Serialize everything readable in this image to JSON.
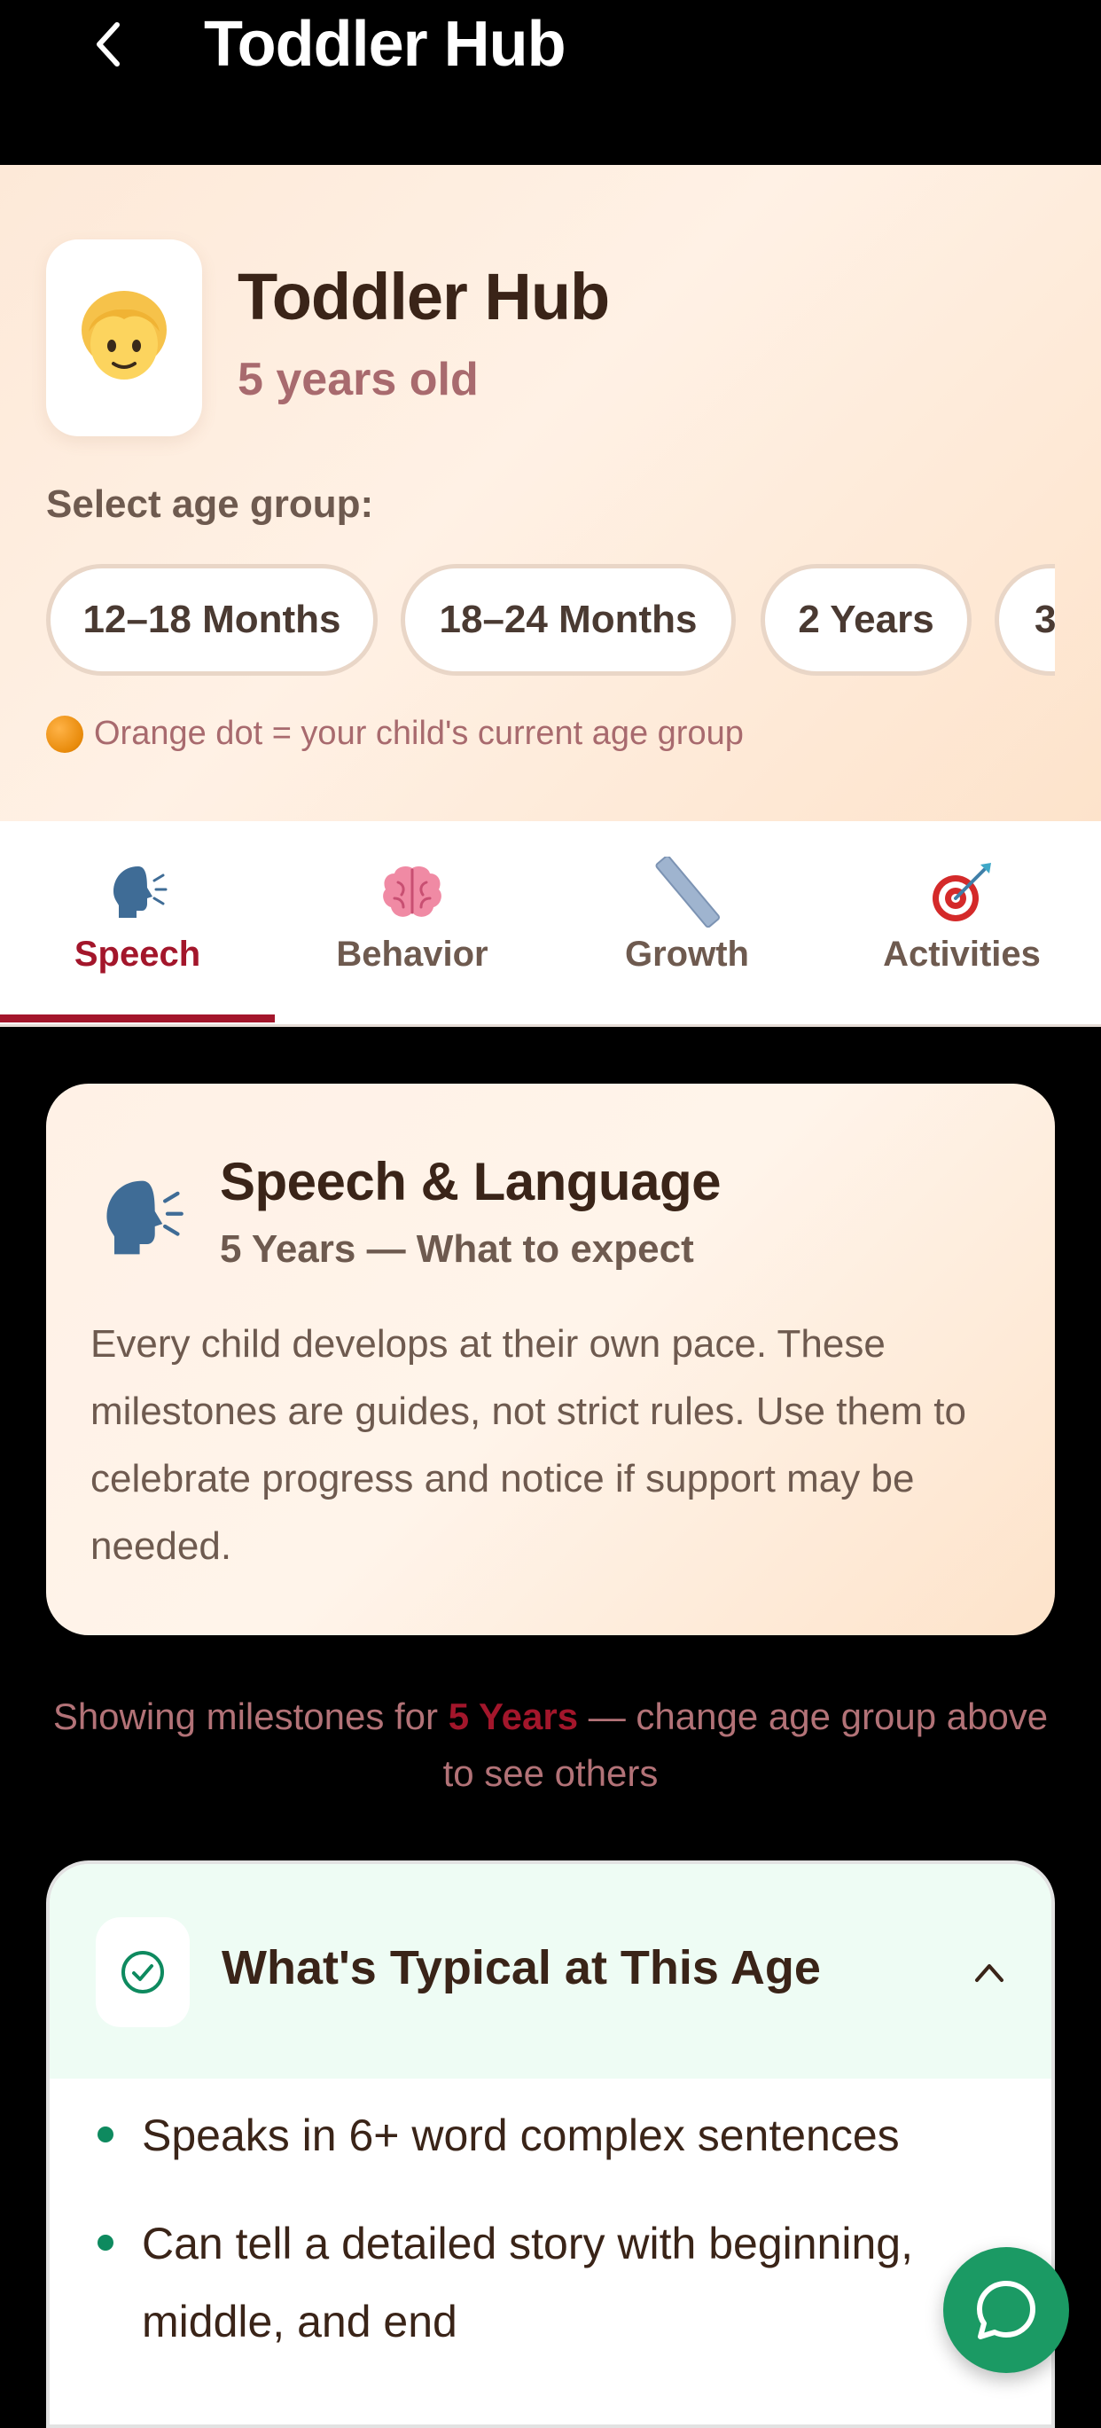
{
  "nav": {
    "title": "Toddler Hub",
    "back_icon": "chevron-left-icon"
  },
  "header": {
    "avatar_emoji": "👱",
    "title": "Toddler Hub",
    "subtitle": "5 years old",
    "age_label": "Select age group:",
    "age_groups": [
      {
        "label": "12–18 Months"
      },
      {
        "label": "18–24 Months"
      },
      {
        "label": "2 Years"
      },
      {
        "label": "3"
      }
    ],
    "legend_text": "Orange dot = your child's current age group",
    "legend_dot_color": "#f0900a"
  },
  "tabs": [
    {
      "label": "Speech",
      "icon": "speaking-head-icon",
      "active": true
    },
    {
      "label": "Behavior",
      "icon": "brain-icon",
      "active": false
    },
    {
      "label": "Growth",
      "icon": "ruler-icon",
      "active": false
    },
    {
      "label": "Activities",
      "icon": "target-icon",
      "active": false
    }
  ],
  "intro": {
    "icon": "speaking-head-icon",
    "title": "Speech & Language",
    "subtitle": "5 Years — What to expect",
    "body": "Every child develops at their own pace. These milestones are guides, not strict rules. Use them to celebrate progress and notice if support may be needed."
  },
  "showing": {
    "prefix": "Showing milestones for ",
    "age": "5 Years",
    "suffix": " — change age group above to see others"
  },
  "typical": {
    "icon": "check-circle-icon",
    "title": "What's Typical at This Age",
    "items": [
      "Speaks in 6+ word complex sentences",
      "Can tell a detailed story with beginning, middle, and end"
    ]
  },
  "colors": {
    "accent": "#a3162b",
    "muted_rose": "#a86a6e",
    "green": "#1b9a64"
  },
  "chat_icon": "chat-bubble-icon"
}
